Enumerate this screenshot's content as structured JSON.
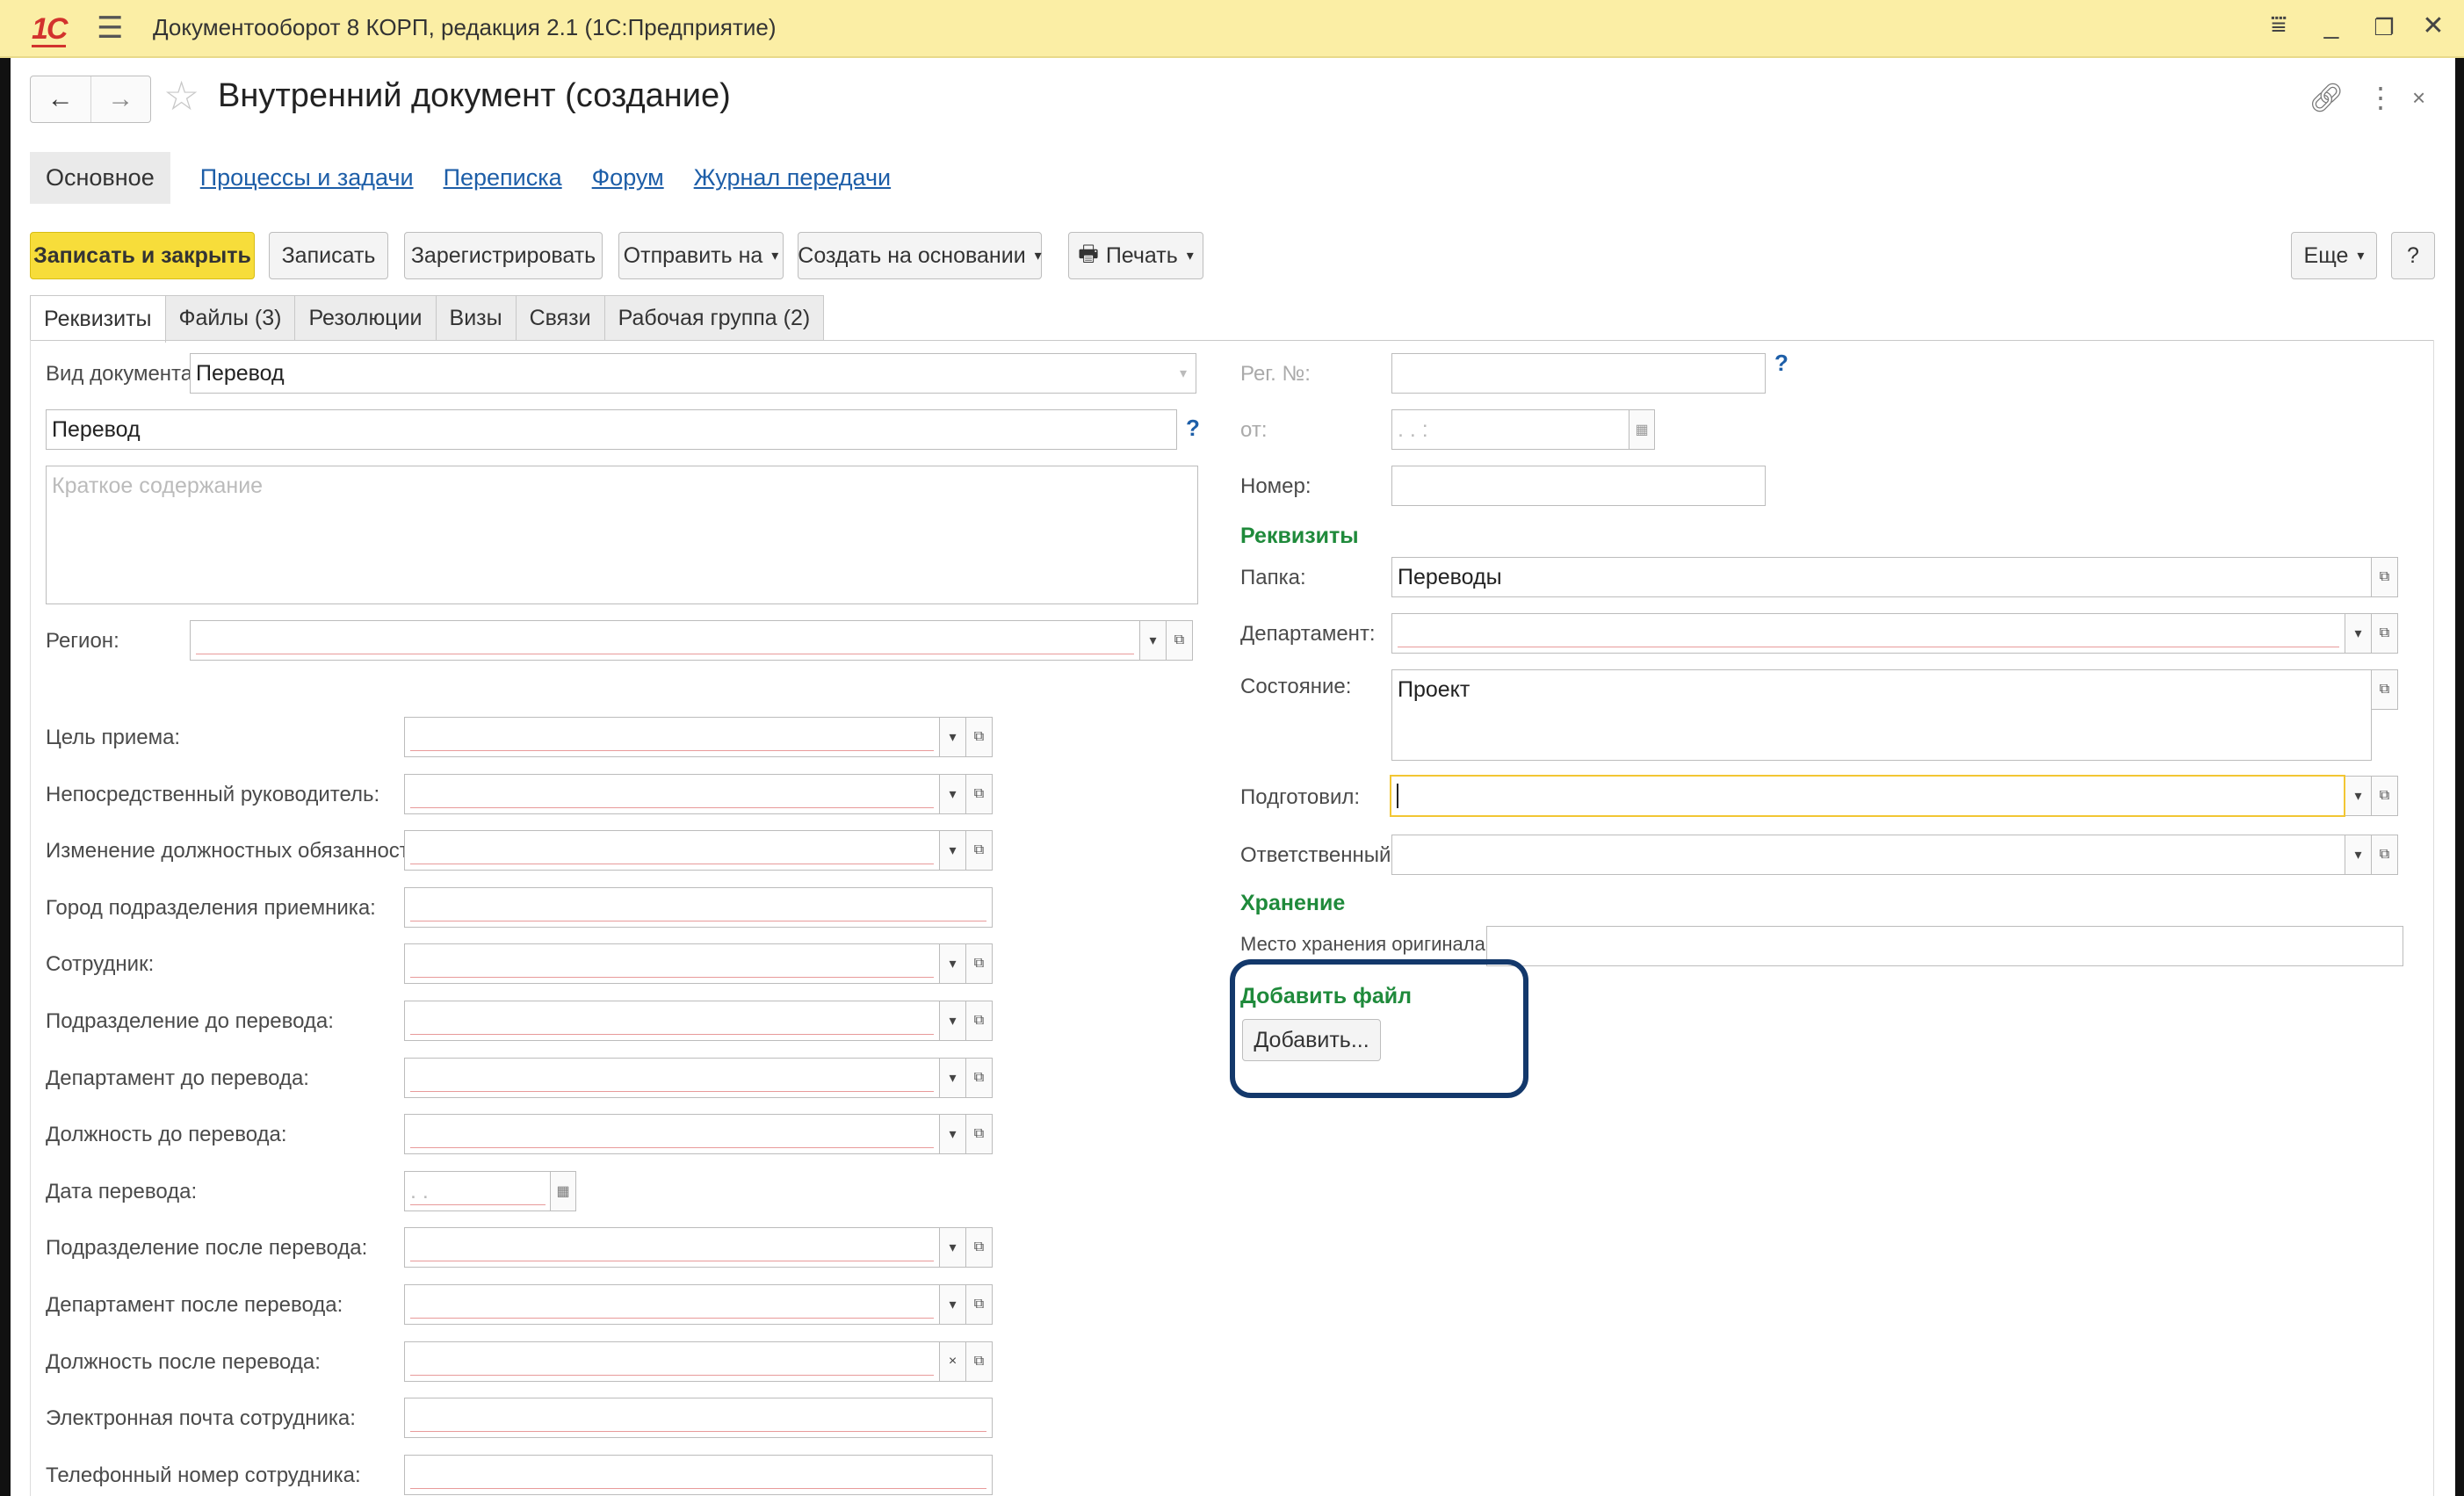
{
  "titlebar": {
    "logo": "1С",
    "title": "Документооборот 8 КОРП, редакция 2.1  (1С:Предприятие)"
  },
  "header": {
    "back": "←",
    "forward": "→",
    "doc_title": "Внутренний документ (создание)"
  },
  "sections": [
    "Основное",
    "Процессы и задачи",
    "Переписка",
    "Форум",
    "Журнал передачи"
  ],
  "commands": {
    "save_close": "Записать и закрыть",
    "save": "Записать",
    "register": "Зарегистрировать",
    "send": "Отправить на",
    "create_based": "Создать на основании",
    "print": "Печать",
    "more": "Еще",
    "help": "?"
  },
  "tabs": [
    "Реквизиты",
    "Файлы (3)",
    "Резолюции",
    "Визы",
    "Связи",
    "Рабочая группа (2)"
  ],
  "left": {
    "doc_kind_label": "Вид документа:",
    "doc_kind_value": "Перевод",
    "subject_value": "Перевод",
    "summary_placeholder": "Краткое содержание",
    "region_label": "Регион:",
    "fields": [
      {
        "label": "Цель приема:",
        "value": ""
      },
      {
        "label": "Непосредственный руководитель:",
        "value": ""
      },
      {
        "label": "Изменение должностных обязанностей:",
        "value": ""
      },
      {
        "label": "Город подразделения приемника:",
        "value": ""
      },
      {
        "label": "Сотрудник:",
        "value": ""
      },
      {
        "label": "Подразделение до перевода:",
        "value": ""
      },
      {
        "label": "Департамент до перевода:",
        "value": ""
      },
      {
        "label": "Должность до перевода:",
        "value": ""
      },
      {
        "label": "Дата перевода:",
        "value": " .  . "
      },
      {
        "label": "Подразделение после перевода:",
        "value": ""
      },
      {
        "label": "Департамент после перевода:",
        "value": ""
      },
      {
        "label": "Должность после перевода:",
        "value": ""
      },
      {
        "label": "Электронная почта сотрудника:",
        "value": ""
      },
      {
        "label": "Телефонный номер сотрудника:",
        "value": ""
      }
    ]
  },
  "right": {
    "reg_no_label": "Рег. №:",
    "from_label": "от:",
    "from_value": " .  .     :  ",
    "number_label": "Номер:",
    "group_requisites": "Реквизиты",
    "folder_label": "Папка:",
    "folder_value": "Переводы",
    "department_label": "Департамент:",
    "state_label": "Состояние:",
    "state_value": "Проект",
    "prepared_label": "Подготовил:",
    "responsible_label": "Ответственный:",
    "group_storage": "Хранение",
    "storage_label": "Место хранения оригинала:",
    "group_add_file": "Добавить файл",
    "add_button": "Добавить..."
  },
  "colors": {
    "titlebar": "#fbeea5",
    "primary_button": "#f7dd3a",
    "group_heading": "#1f8a3b",
    "link": "#1d5ea8",
    "highlight_frame": "#13386b"
  }
}
